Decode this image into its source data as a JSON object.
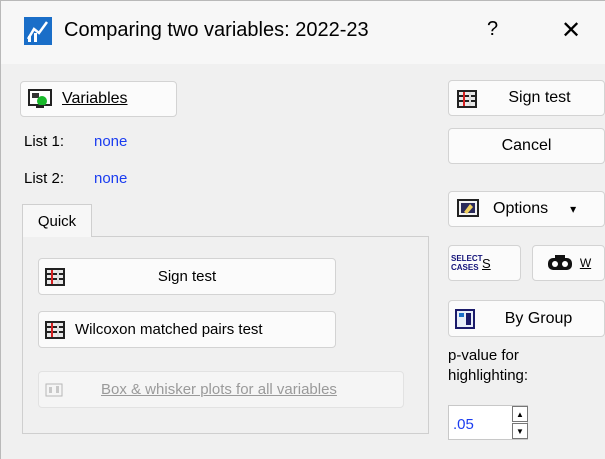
{
  "window": {
    "title": "Comparing two variables: 2022-23",
    "help_glyph": "?",
    "close_glyph": "✕"
  },
  "variables_button": {
    "label": "Variables",
    "icon": "variables-icon"
  },
  "lists": [
    {
      "label": "List 1:",
      "value": "none"
    },
    {
      "label": "List 2:",
      "value": "none"
    }
  ],
  "tabs": [
    {
      "label": "Quick",
      "selected": true
    }
  ],
  "quick": {
    "sign_test_label": "Sign test",
    "wilcoxon_label": "Wilcoxon matched pairs test",
    "boxplot_label": "Box & whisker plots for all variables"
  },
  "side": {
    "sign_test_label": "Sign test",
    "cancel_label": "Cancel",
    "options_label": "Options",
    "options_arrow": "▾",
    "select_cases_icon_text": "SELECT CASES",
    "select_cases_label": "S",
    "weight_label": "W",
    "by_group_label": "By Group",
    "pvalue_label_line1": "p-value for",
    "pvalue_label_line2": "highlighting:",
    "pvalue_value": ".05"
  },
  "colors": {
    "link_blue": "#1a3cf0",
    "disabled_text": "#9a9a9a"
  }
}
